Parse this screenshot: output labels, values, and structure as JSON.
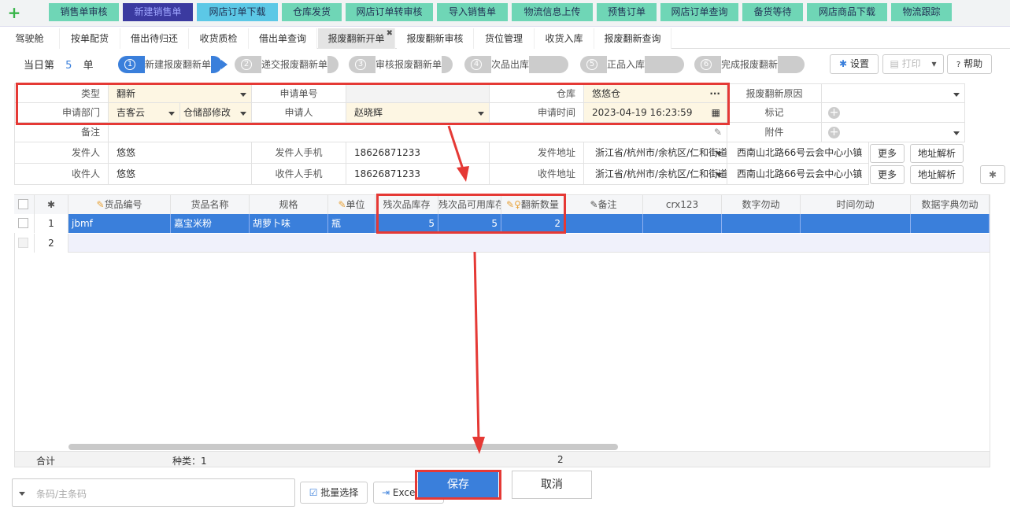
{
  "topnav": {
    "plus": "+",
    "items": [
      "销售单审核",
      "新建销售单",
      "网店订单下载",
      "仓库发货",
      "网店订单转审核",
      "导入销售单",
      "物流信息上传",
      "预售订单",
      "网店订单查询",
      "备货等待",
      "网店商品下载",
      "物流跟踪"
    ]
  },
  "tabs": [
    "驾驶舱",
    "按单配货",
    "借出待归还",
    "收货质检",
    "借出单查询",
    "报废翻新开单",
    "报废翻新审核",
    "货位管理",
    "收货入库",
    "报废翻新查询"
  ],
  "tab_close": "✖",
  "today": {
    "prefix": "当日第",
    "count": "5",
    "suffix": "单"
  },
  "steps": [
    {
      "num": "1",
      "label": "新建报废翻新单"
    },
    {
      "num": "2",
      "label": "递交报废翻新单"
    },
    {
      "num": "3",
      "label": "审核报废翻新单"
    },
    {
      "num": "4",
      "label": "次品出库"
    },
    {
      "num": "5",
      "label": "正品入库"
    },
    {
      "num": "6",
      "label": "完成报废翻新"
    }
  ],
  "toolbar": {
    "settings": "设置",
    "print": "打印",
    "help": "帮助"
  },
  "form": {
    "type_label": "类型",
    "type_value": "翻新",
    "order_no_label": "申请单号",
    "order_no_value": "",
    "warehouse_label": "仓库",
    "warehouse_value": "悠悠仓",
    "warehouse_more": "···",
    "reason_label": "报废翻新原因",
    "reason_value": "",
    "dept_label": "申请部门",
    "dept_value": "吉客云",
    "dept_value2": "仓储部修改",
    "applicant_label": "申请人",
    "applicant_value": "赵晓辉",
    "time_label": "申请时间",
    "time_value": "2023-04-19 16:23:59",
    "tag_label": "标记",
    "remark_label": "备注",
    "remark_value": "",
    "attach_label": "附件",
    "sender_label": "发件人",
    "sender_value": "悠悠",
    "sender_phone_label": "发件人手机",
    "sender_phone_value": "18626871233",
    "sender_addr_label": "发件地址",
    "sender_addr_value": "浙江省/杭州市/余杭区/仁和街道",
    "sender_detail": "西南山北路66号云会中心小镇",
    "more": "更多",
    "parse": "地址解析",
    "receiver_label": "收件人",
    "receiver_value": "悠悠",
    "receiver_phone_label": "收件人手机",
    "receiver_phone_value": "18626871233",
    "receiver_addr_label": "收件地址",
    "receiver_addr_value": "浙江省/杭州市/余杭区/仁和街道",
    "receiver_detail": "西南山北路66号云会中心小镇"
  },
  "grid": {
    "columns": [
      "货品编号",
      "货品名称",
      "规格",
      "单位",
      "残次品库存",
      "残次品可用库存",
      "翻新数量",
      "备注",
      "crx123",
      "数字勿动",
      "时间勿动",
      "数据字典勿动"
    ],
    "rows": [
      {
        "idx": "1",
        "code": "jbmf",
        "name": "嘉宝米粉",
        "spec": "胡萝卜味",
        "unit": "瓶",
        "stock": "5",
        "avail": "5",
        "qty": "2",
        "remark": "",
        "crx": "",
        "num": "",
        "time": "",
        "dict": ""
      },
      {
        "idx": "2"
      }
    ],
    "footer": {
      "total": "合计",
      "kinds": "种类：1",
      "qty_sum": "2"
    }
  },
  "bottom": {
    "barcode_placeholder": "条码/主条码",
    "batch": "批量选择",
    "excel": "Excel",
    "save": "保存",
    "cancel": "取消"
  },
  "colors": {
    "highlight": "#e53935",
    "accent": "#3a7fdb"
  }
}
